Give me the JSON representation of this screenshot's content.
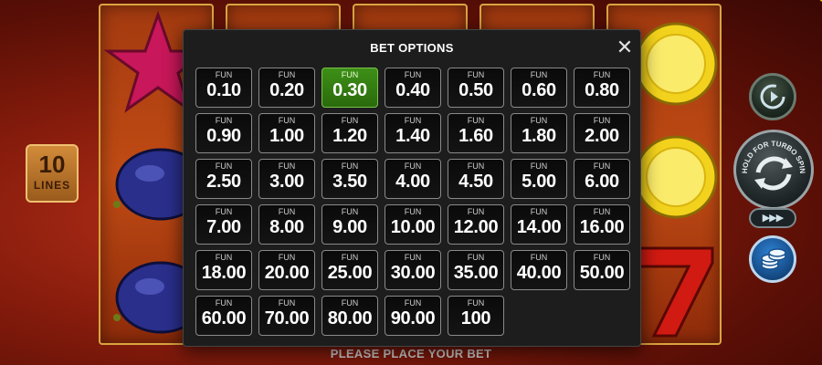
{
  "lines": {
    "number": "10",
    "label": "LINES"
  },
  "spin": {
    "turbo_text": "HOLD FOR TURBO SPIN",
    "fast_forward": "▶▶▶"
  },
  "colors": {
    "selected": "#3d8f17",
    "modal_bg": "#1d1d1d",
    "accent_gold": "#d9a441"
  },
  "icons": {
    "close": "close-icon",
    "autoplay": "autoplay-icon",
    "spin": "spin-icon",
    "coins": "coins-icon"
  },
  "bet_options": {
    "title": "BET OPTIONS",
    "close_label": "✕",
    "currency_label": "FUN",
    "selected_value": "0.30",
    "values": [
      "0.10",
      "0.20",
      "0.30",
      "0.40",
      "0.50",
      "0.60",
      "0.80",
      "0.90",
      "1.00",
      "1.20",
      "1.40",
      "1.60",
      "1.80",
      "2.00",
      "2.50",
      "3.00",
      "3.50",
      "4.00",
      "4.50",
      "5.00",
      "6.00",
      "7.00",
      "8.00",
      "9.00",
      "10.00",
      "12.00",
      "14.00",
      "16.00",
      "18.00",
      "20.00",
      "25.00",
      "30.00",
      "35.00",
      "40.00",
      "50.00",
      "60.00",
      "70.00",
      "80.00",
      "90.00",
      "100"
    ]
  },
  "status": {
    "message": "PLEASE PLACE YOUR BET"
  }
}
